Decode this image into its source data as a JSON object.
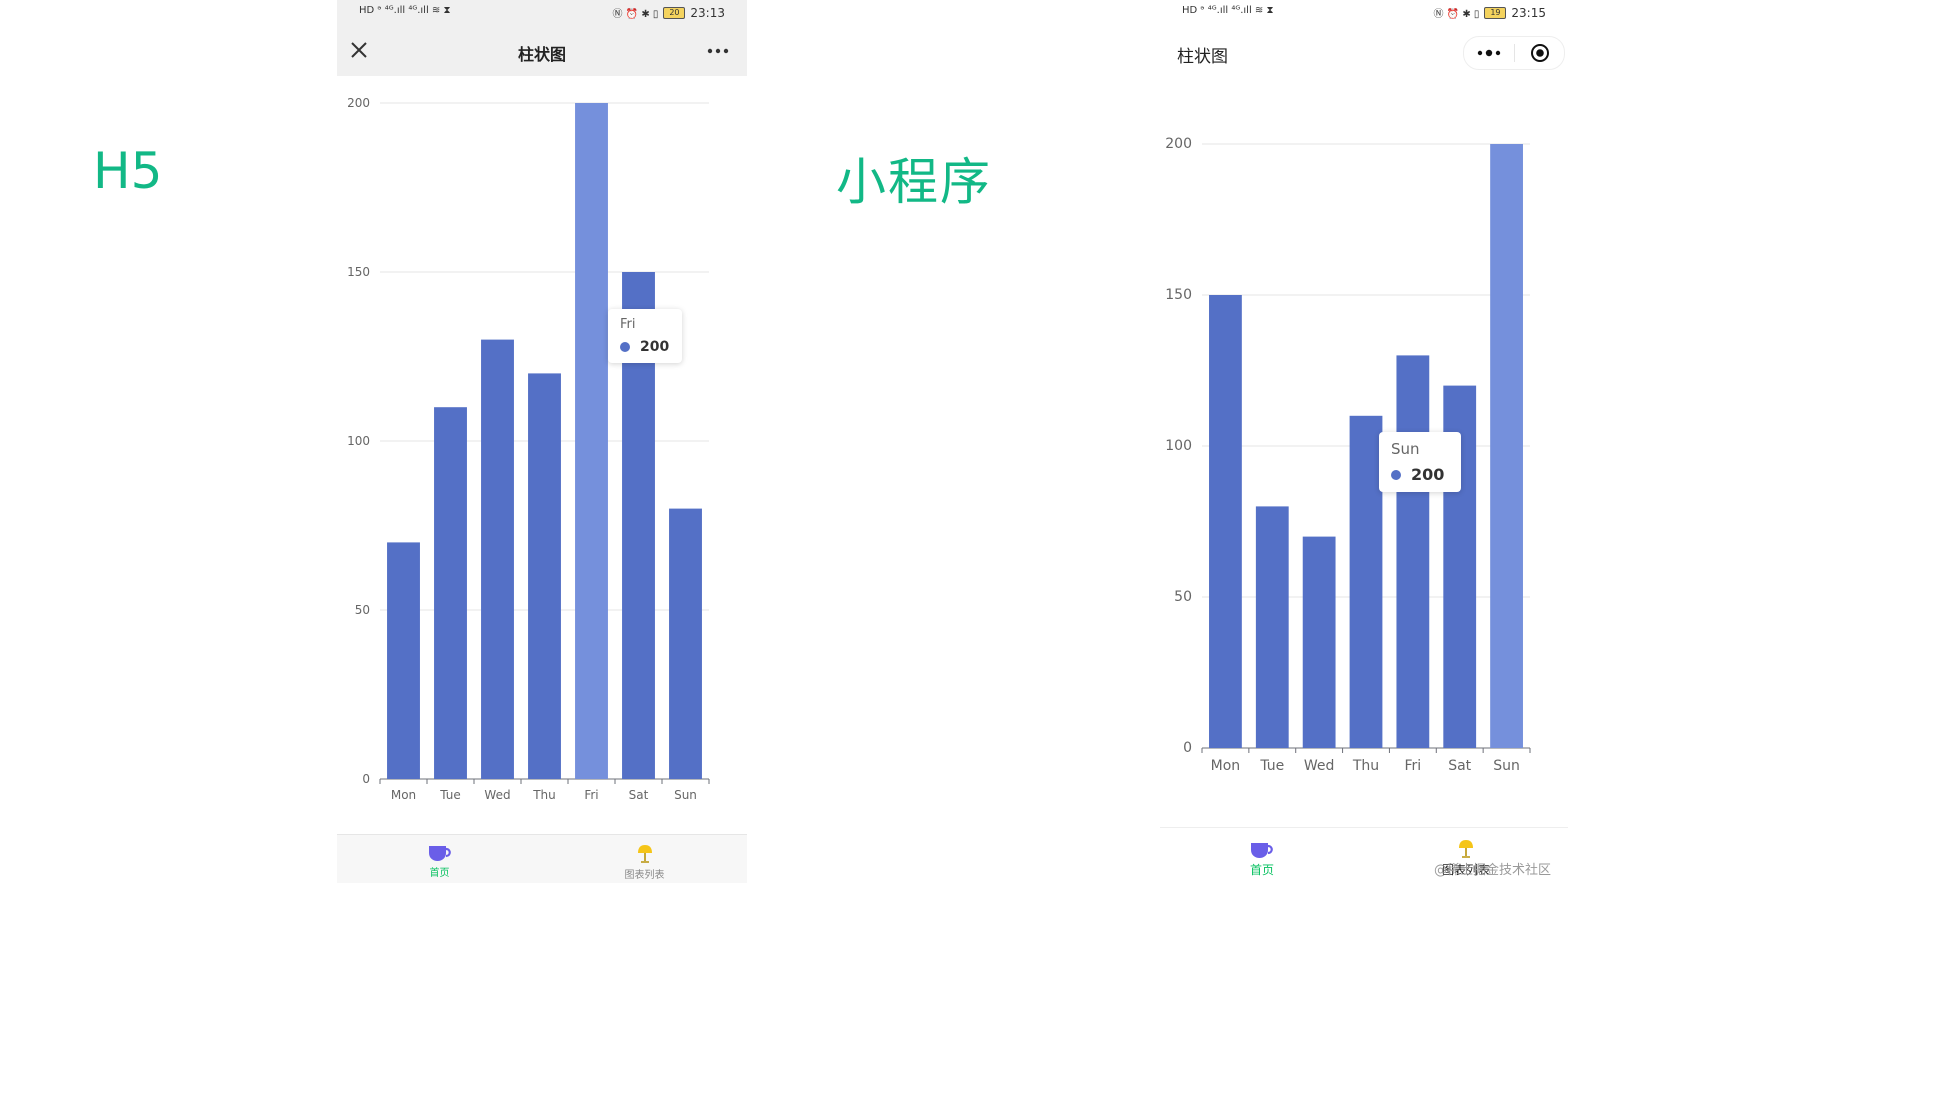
{
  "labels": {
    "h5": "H5",
    "miniprogram": "小程序"
  },
  "colors": {
    "bar": "#5470c6",
    "bar_emphasis": "#7590dc",
    "label_green": "#12b886",
    "tab_active": "#07c160"
  },
  "h5": {
    "statusbar": {
      "left_icons": "HD ᵊ ⁴ᴳ.ıll ⁴ᴳ.ıll ≋ ⧗",
      "right_icons": "Ⓝ ⏰ ✱ ▯",
      "battery": "20",
      "time": "23:13"
    },
    "navbar": {
      "title": "柱状图",
      "close_icon": "close-icon",
      "more_icon": "more-icon"
    },
    "tooltip": {
      "name": "Fri",
      "value": "200"
    },
    "tabbar": [
      {
        "label": "首页",
        "icon": "cup-icon",
        "active": true
      },
      {
        "label": "图表列表",
        "icon": "lamp-icon",
        "active": false
      }
    ]
  },
  "miniprogram": {
    "statusbar": {
      "left_icons": "HD ᵊ ⁴ᴳ.ıll ⁴ᴳ.ıll ≋ ⧗",
      "right_icons": "Ⓝ ⏰ ✱ ▯",
      "battery": "19",
      "time": "23:15"
    },
    "navbar": {
      "title": "柱状图",
      "menu_icon": "capsule-more-icon",
      "close_icon": "capsule-target-icon"
    },
    "tooltip": {
      "name": "Sun",
      "value": "200"
    },
    "tabbar": [
      {
        "label": "首页",
        "icon": "cup-icon",
        "active": true
      },
      {
        "label": "图表列表",
        "icon": "lamp-icon",
        "active": false
      }
    ]
  },
  "watermark": "@稀土掘金技术社区",
  "chart_data": [
    {
      "type": "bar",
      "title": "",
      "categories": [
        "Mon",
        "Tue",
        "Wed",
        "Thu",
        "Fri",
        "Sat",
        "Sun"
      ],
      "values": [
        70,
        110,
        130,
        120,
        200,
        150,
        80
      ],
      "ylim": [
        0,
        200
      ],
      "yticks": [
        0,
        50,
        100,
        150,
        200
      ],
      "grid": true,
      "highlighted": "Fri"
    },
    {
      "type": "bar",
      "title": "",
      "categories": [
        "Mon",
        "Tue",
        "Wed",
        "Thu",
        "Fri",
        "Sat",
        "Sun"
      ],
      "values": [
        150,
        80,
        70,
        110,
        130,
        120,
        200
      ],
      "ylim": [
        0,
        200
      ],
      "yticks": [
        0,
        50,
        100,
        150,
        200
      ],
      "grid": true,
      "highlighted": "Sun"
    }
  ]
}
